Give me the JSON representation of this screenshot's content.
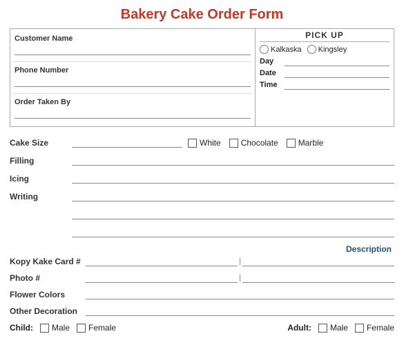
{
  "title": "Bakery Cake Order Form",
  "topSection": {
    "leftFields": [
      {
        "label": "Customer Name"
      },
      {
        "label": "Phone Number"
      },
      {
        "label": "Order Taken By"
      }
    ],
    "rightSection": {
      "header": "PICK UP",
      "locations": [
        "Kalkaska",
        "Kingsley"
      ],
      "fields": [
        "Day",
        "Date",
        "Time"
      ]
    }
  },
  "cakeSection": {
    "sizeLabel": "Cake Size",
    "types": [
      "White",
      "Chocolate",
      "Marble"
    ]
  },
  "formFields": [
    {
      "label": "Filling"
    },
    {
      "label": "Icing"
    },
    {
      "label": "Writing"
    },
    {
      "label": ""
    },
    {
      "label": ""
    }
  ],
  "descSection": {
    "header": "Description",
    "rows": [
      {
        "label": "Kopy Kake Card #"
      },
      {
        "label": "Photo #"
      },
      {
        "label": "Flower Colors"
      },
      {
        "label": "Other Decoration"
      }
    ]
  },
  "bottomSection": {
    "childLabel": "Child:",
    "childOptions": [
      "Male",
      "Female"
    ],
    "adultLabel": "Adult:",
    "adultOptions": [
      "Male",
      "Female"
    ]
  }
}
